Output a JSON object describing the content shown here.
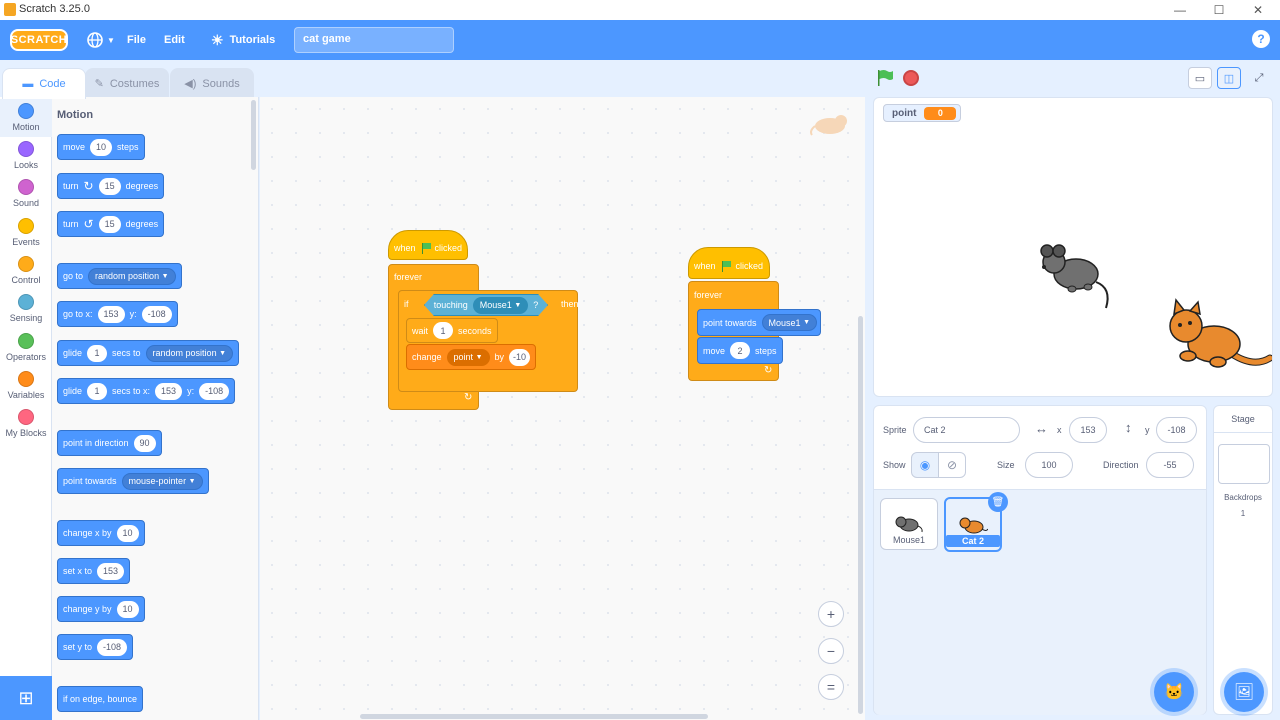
{
  "window": {
    "title": "Scratch 3.25.0",
    "minimize": "—",
    "maximize": "☐",
    "close": "✕"
  },
  "menubar": {
    "logo": "SCRATCH",
    "file": "File",
    "edit": "Edit",
    "tutorials": "Tutorials",
    "project_title": "cat game",
    "help": "?"
  },
  "tabs": {
    "code": "Code",
    "costumes": "Costumes",
    "sounds": "Sounds"
  },
  "categories": [
    {
      "label": "Motion",
      "color": "#4c97ff"
    },
    {
      "label": "Looks",
      "color": "#9966ff"
    },
    {
      "label": "Sound",
      "color": "#cf63cf"
    },
    {
      "label": "Events",
      "color": "#ffbf00"
    },
    {
      "label": "Control",
      "color": "#ffab19"
    },
    {
      "label": "Sensing",
      "color": "#5cb1d6"
    },
    {
      "label": "Operators",
      "color": "#59c059"
    },
    {
      "label": "Variables",
      "color": "#ff8c1a"
    },
    {
      "label": "My Blocks",
      "color": "#ff6680"
    }
  ],
  "palette": {
    "heading": "Motion",
    "move": {
      "a": "move",
      "v": "10",
      "b": "steps"
    },
    "turn_right": {
      "a": "turn",
      "v": "15",
      "b": "degrees"
    },
    "turn_left": {
      "a": "turn",
      "v": "15",
      "b": "degrees"
    },
    "goto": {
      "a": "go to",
      "d": "random position"
    },
    "goto_xy": {
      "a": "go to x:",
      "x": "153",
      "b": "y:",
      "y": "-108"
    },
    "glide": {
      "a": "glide",
      "v": "1",
      "b": "secs to",
      "d": "random position"
    },
    "glide_xy": {
      "a": "glide",
      "v": "1",
      "b": "secs to x:",
      "x": "153",
      "c": "y:",
      "y": "-108"
    },
    "point_dir": {
      "a": "point in direction",
      "v": "90"
    },
    "point_towards": {
      "a": "point towards",
      "d": "mouse-pointer"
    },
    "change_x": {
      "a": "change x by",
      "v": "10"
    },
    "set_x": {
      "a": "set x to",
      "v": "153"
    },
    "change_y": {
      "a": "change y by",
      "v": "10"
    },
    "set_y": {
      "a": "set y to",
      "v": "-108"
    },
    "bounce": {
      "a": "if on edge, bounce"
    }
  },
  "script1": {
    "hat": {
      "a": "when",
      "b": "clicked"
    },
    "forever": "forever",
    "if": {
      "a": "if",
      "b": "then"
    },
    "touching": {
      "a": "touching",
      "d": "Mouse1",
      "q": "?"
    },
    "wait": {
      "a": "wait",
      "v": "1",
      "b": "seconds"
    },
    "change": {
      "a": "change",
      "d": "point",
      "b": "by",
      "v": "-10"
    }
  },
  "script2": {
    "hat": {
      "a": "when",
      "b": "clicked"
    },
    "forever": "forever",
    "point": {
      "a": "point towards",
      "d": "Mouse1"
    },
    "move": {
      "a": "move",
      "v": "2",
      "b": "steps"
    }
  },
  "zoom": {
    "in": "+",
    "out": "−",
    "reset": "="
  },
  "stage": {
    "monitor_label": "point",
    "monitor_value": "0"
  },
  "sprite_info": {
    "sprite_label": "Sprite",
    "sprite_name": "Cat 2",
    "x_label": "x",
    "x": "153",
    "y_label": "y",
    "y": "-108",
    "show_label": "Show",
    "size_label": "Size",
    "size": "100",
    "direction_label": "Direction",
    "direction": "-55"
  },
  "sprites": [
    {
      "name": "Mouse1"
    },
    {
      "name": "Cat 2"
    }
  ],
  "stage_pane": {
    "title": "Stage",
    "backdrops_label": "Backdrops",
    "backdrops_count": "1"
  }
}
